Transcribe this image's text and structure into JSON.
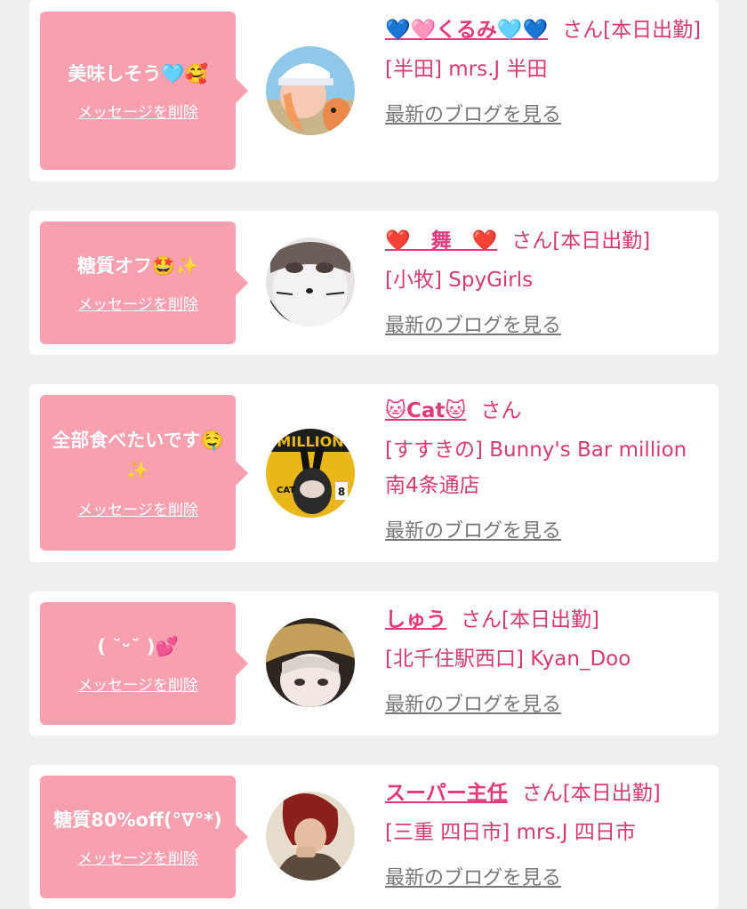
{
  "cards": [
    {
      "bubble_text": "美味しそう🩵🥰",
      "delete_label": "メッセージを削除",
      "name": "💙🩷くるみ🩵💙",
      "san_status": "さん[本日出勤]",
      "shop": "[半田] mrs.J 半田",
      "blog_label": "最新のブログを見る"
    },
    {
      "bubble_text": "糖質オフ🤩✨",
      "delete_label": "メッセージを削除",
      "name": "❤️　舞　❤️",
      "san_status": "さん[本日出勤]",
      "shop": "[小牧] SpyGirls",
      "blog_label": "最新のブログを見る"
    },
    {
      "bubble_text": "全部食べたいです🤤✨",
      "delete_label": "メッセージを削除",
      "name": "🐱Cat🐱",
      "san_status": "さん",
      "shop": "[すすきの] Bunny's Bar million 南4条通店",
      "blog_label": "最新のブログを見る"
    },
    {
      "bubble_text": "( ˘ᵕ˘ )💕",
      "delete_label": "メッセージを削除",
      "name": "しゅう",
      "san_status": "さん[本日出勤]",
      "shop": "[北千住駅西口] Kyan_Doo",
      "blog_label": "最新のブログを見る"
    },
    {
      "bubble_text": "糖質80%off(°∇°*)",
      "delete_label": "メッセージを削除",
      "name": "スーパー主任",
      "san_status": "さん[本日出勤]",
      "shop": "[三重 四日市] mrs.J 四日市",
      "blog_label": "最新のブログを見る"
    }
  ],
  "colors": {
    "bubble": "#f9a0b0",
    "accent_pink": "#e2387c",
    "text_pink": "#d63a6e",
    "muted_link": "#777777",
    "page_bg": "#efefef"
  }
}
